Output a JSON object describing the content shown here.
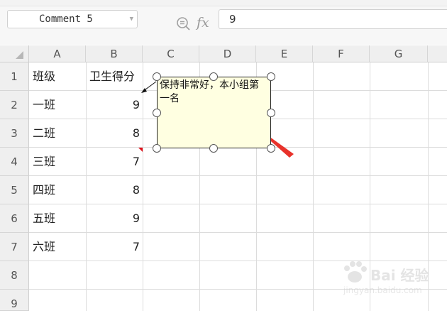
{
  "name_box": {
    "value": "Comment 5"
  },
  "formula_bar": {
    "fx_label": "fx",
    "value": "9"
  },
  "columns": [
    "A",
    "B",
    "C",
    "D",
    "E",
    "F",
    "G"
  ],
  "rows": [
    "1",
    "2",
    "3",
    "4",
    "5",
    "6",
    "7",
    "8",
    "9"
  ],
  "cells": {
    "a1": "班级",
    "b1": "卫生得分",
    "a2": "一班",
    "b2": "9",
    "a3": "二班",
    "b3": "8",
    "a4": "三班",
    "b4": "7",
    "a5": "四班",
    "b5": "8",
    "a6": "五班",
    "b6": "9",
    "a7": "六班",
    "b7": "7"
  },
  "comment": {
    "text": "保持非常好，本小组第一名"
  },
  "icons": {
    "zoom": "zoom-formula-icon",
    "dropdown": "chevron-down-icon"
  },
  "colors": {
    "comment_bg": "#ffffe1",
    "annotation_arrow": "#e8322b",
    "comment_marker": "#e0101a"
  },
  "watermark": {
    "brand": "Bai 经验",
    "url": "jingyan.baidu.com"
  }
}
